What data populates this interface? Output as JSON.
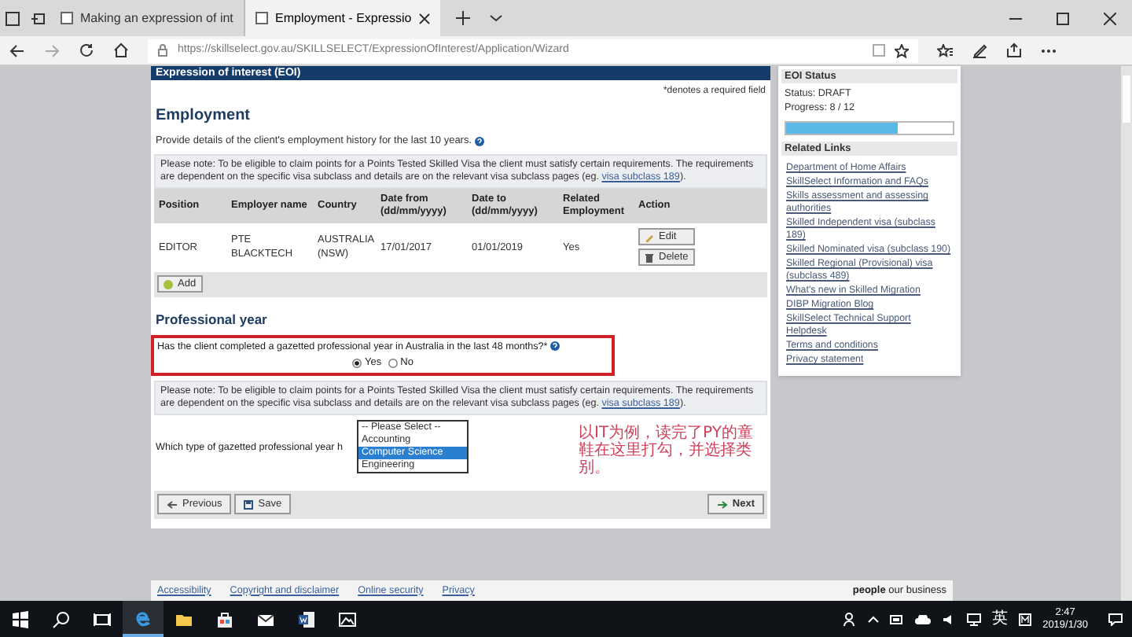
{
  "browser": {
    "tabs": [
      {
        "title": "Making an expression of int",
        "selected": false
      },
      {
        "title": "Employment - Expressio",
        "selected": true
      }
    ],
    "url": "https://skillselect.gov.au/SKILLSELECT/ExpressionOfInterest/Application/Wizard"
  },
  "page": {
    "header": "Expression of interest (EOI)",
    "required_note": "*denotes a required field",
    "employment": {
      "heading": "Employment",
      "intro": "Provide details of the client's employment history for the last 10 years.",
      "note": {
        "text": "Please note: To be eligible to claim points for a Points Tested Skilled Visa the client must satisfy certain requirements. The requirements are dependent on the specific visa subclass and details are on the relevant visa subclass pages (eg. ",
        "link": "visa subclass 189",
        "after": ")."
      },
      "table": {
        "columns": [
          "Position",
          "Employer name",
          "Country",
          "Date from (dd/mm/yyyy)",
          "Date to (dd/mm/yyyy)",
          "Related Employment",
          "Action"
        ],
        "rows": [
          {
            "cells": [
              "EDITOR",
              "PTE BLACKTECH",
              "AUSTRALIA (NSW)",
              "17/01/2017",
              "01/01/2019",
              "Yes"
            ],
            "actions": [
              "Edit",
              "Delete"
            ]
          }
        ]
      },
      "add_button": "Add"
    },
    "professional_year": {
      "heading": "Professional year",
      "question": "Has the client completed a gazetted professional year in Australia in the last 48 months?*",
      "options": [
        {
          "label": "Yes",
          "selected": true
        },
        {
          "label": "No",
          "selected": false
        }
      ],
      "note": {
        "text": "Please note: To be eligible to claim points for a Points Tested Skilled Visa the client must satisfy certain requirements. The requirements are dependent on the specific visa subclass and details are on the relevant visa subclass pages (eg. ",
        "link": "visa subclass 189",
        "after": ")."
      },
      "question2": "Which type of gazetted professional year h",
      "dropdown": [
        {
          "label": "-- Please Select --",
          "selected": false
        },
        {
          "label": "Accounting",
          "selected": false
        },
        {
          "label": "Computer Science",
          "selected": true
        },
        {
          "label": "Engineering",
          "selected": false
        }
      ]
    },
    "annotation": "以IT为例，读完了PY的童鞋在这里打勾，并选择类别。",
    "nav": {
      "previous": "Previous",
      "save": "Save",
      "next": "Next"
    }
  },
  "sidebar": {
    "status": {
      "title": "EOI Status",
      "status": "Status: DRAFT",
      "progress": "Progress: 8 / 12",
      "level": 0.667
    },
    "links_title": "Related Links",
    "links": [
      "Department of Home Affairs",
      "SkillSelect Information and FAQs",
      "Skills assessment and assessing authorities",
      "Skilled Independent visa (subclass 189)",
      "Skilled Nominated visa (subclass 190)",
      "Skilled Regional (Provisional) visa (subclass 489)",
      "What's new in Skilled Migration",
      "DIBP Migration Blog",
      "SkillSelect Technical Support Helpdesk",
      "Terms and conditions",
      "Privacy statement"
    ]
  },
  "footer": {
    "links": [
      "Accessibility",
      "Copyright and disclaimer",
      "Online security",
      "Privacy"
    ],
    "tagline": "**people** our business"
  },
  "taskbar": {
    "input_indicator": "英",
    "time": "2:47",
    "date": "2019/1/30"
  }
}
